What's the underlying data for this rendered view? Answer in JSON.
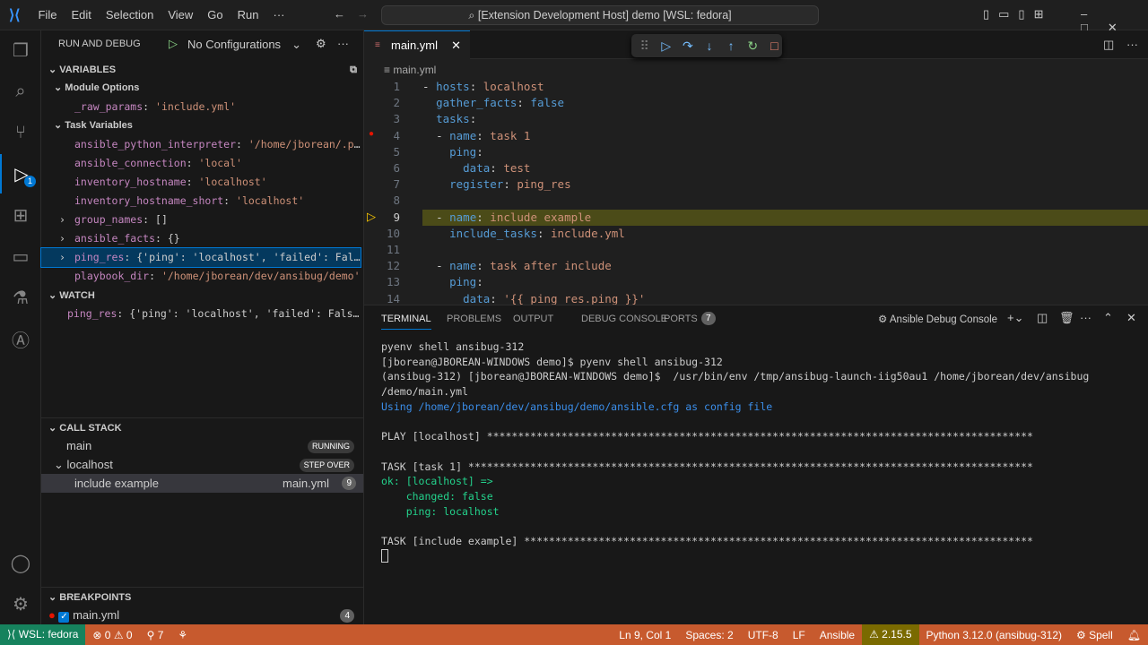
{
  "title": "[Extension Development Host] demo [WSL: fedora]",
  "menu": [
    "File",
    "Edit",
    "Selection",
    "View",
    "Go",
    "Run",
    "···"
  ],
  "activity": {
    "debug_badge": "1"
  },
  "sidebar": {
    "header": "RUN AND DEBUG",
    "config": "No Configurations",
    "variables": {
      "title": "VARIABLES",
      "module_options": {
        "label": "Module Options",
        "items": [
          {
            "name": "_raw_params",
            "value": "'include.yml'"
          }
        ]
      },
      "task_variables": {
        "label": "Task Variables",
        "items": [
          {
            "name": "ansible_python_interpreter",
            "value": "'/home/jborean/.pyenv/...'",
            "expand": ""
          },
          {
            "name": "ansible_connection",
            "value": "'local'",
            "expand": ""
          },
          {
            "name": "inventory_hostname",
            "value": "'localhost'",
            "expand": ""
          },
          {
            "name": "inventory_hostname_short",
            "value": "'localhost'",
            "expand": ""
          },
          {
            "name": "group_names",
            "value": "[]",
            "expand": "›"
          },
          {
            "name": "ansible_facts",
            "value": "{}",
            "expand": "›"
          },
          {
            "name": "ping_res",
            "value": "{'ping': 'localhost', 'failed': False...}",
            "expand": "›"
          },
          {
            "name": "playbook_dir",
            "value": "'/home/jborean/dev/ansibug/demo'",
            "expand": ""
          }
        ]
      }
    },
    "watch": {
      "title": "WATCH",
      "items": [
        {
          "name": "ping_res",
          "value": "{'ping': 'localhost', 'failed': False...}"
        }
      ]
    },
    "callstack": {
      "title": "CALL STACK",
      "threads": [
        {
          "name": "main",
          "state": "RUNNING"
        },
        {
          "name": "localhost",
          "state": "STEP OVER"
        }
      ],
      "frame": {
        "name": "include example",
        "file": "main.yml",
        "line": "9"
      }
    },
    "breakpoints": {
      "title": "BREAKPOINTS",
      "items": [
        {
          "file": "main.yml",
          "count": "4"
        }
      ]
    }
  },
  "editor": {
    "tab": "main.yml",
    "breadcrumb": "main.yml",
    "lines": [
      {
        "n": "1",
        "ind": "",
        "dash": "- ",
        "key": "hosts",
        "val": " localhost"
      },
      {
        "n": "2",
        "ind": "  ",
        "dash": "",
        "key": "gather_facts",
        "val": " false"
      },
      {
        "n": "3",
        "ind": "  ",
        "dash": "",
        "key": "tasks",
        "val": ""
      },
      {
        "n": "4",
        "ind": "  ",
        "dash": "- ",
        "key": "name",
        "val": " task 1"
      },
      {
        "n": "5",
        "ind": "    ",
        "dash": "",
        "key": "ping",
        "val": ""
      },
      {
        "n": "6",
        "ind": "      ",
        "dash": "",
        "key": "data",
        "val": " test"
      },
      {
        "n": "7",
        "ind": "    ",
        "dash": "",
        "key": "register",
        "val": " ping_res"
      },
      {
        "n": "8",
        "ind": "",
        "dash": "",
        "key": "",
        "val": ""
      },
      {
        "n": "9",
        "ind": "  ",
        "dash": "- ",
        "key": "name",
        "val": " include example"
      },
      {
        "n": "10",
        "ind": "    ",
        "dash": "",
        "key": "include_tasks",
        "val": " include.yml"
      },
      {
        "n": "11",
        "ind": "",
        "dash": "",
        "key": "",
        "val": ""
      },
      {
        "n": "12",
        "ind": "  ",
        "dash": "- ",
        "key": "name",
        "val": " task after include"
      },
      {
        "n": "13",
        "ind": "    ",
        "dash": "",
        "key": "ping",
        "val": ""
      },
      {
        "n": "14",
        "ind": "      ",
        "dash": "",
        "key": "data",
        "val": " '{{ ping_res.ping }}'"
      }
    ]
  },
  "panel": {
    "tabs": [
      "TERMINAL",
      "PROBLEMS",
      "OUTPUT",
      "DEBUG CONSOLE",
      "PORTS"
    ],
    "ports_count": "7",
    "terminal_name": "Ansible Debug Console",
    "lines": [
      {
        "t": "pyenv shell ansibug-312",
        "c": "#cccccc"
      },
      {
        "t": "[jborean@JBOREAN-WINDOWS demo]$ pyenv shell ansibug-312",
        "c": "#cccccc"
      },
      {
        "t": "(ansibug-312) [jborean@JBOREAN-WINDOWS demo]$  /usr/bin/env /tmp/ansibug-launch-iig50au1 /home/jborean/dev/ansibug",
        "c": "#cccccc"
      },
      {
        "t": "/demo/main.yml",
        "c": "#cccccc"
      },
      {
        "t": "Using /home/jborean/dev/ansibug/demo/ansible.cfg as config file",
        "c": "#3b8eea"
      },
      {
        "t": "",
        "c": "#cccccc"
      },
      {
        "t": "PLAY [localhost] ****************************************************************************************",
        "c": "#cccccc"
      },
      {
        "t": "",
        "c": "#cccccc"
      },
      {
        "t": "TASK [task 1] *******************************************************************************************",
        "c": "#cccccc"
      },
      {
        "t": "ok: [localhost] =>",
        "c": "#23d18b"
      },
      {
        "t": "    changed: false",
        "c": "#23d18b"
      },
      {
        "t": "    ping: localhost",
        "c": "#23d18b"
      },
      {
        "t": "",
        "c": "#cccccc"
      },
      {
        "t": "TASK [include example] **********************************************************************************",
        "c": "#cccccc"
      }
    ]
  },
  "status": {
    "remote": "WSL: fedora",
    "errors": "0",
    "warnings": "0",
    "ports": "7",
    "position": "Ln 9, Col 1",
    "spaces": "Spaces: 2",
    "encoding": "UTF-8",
    "eol": "LF",
    "language": "Ansible",
    "ansible_version": "⚠ 2.15.5",
    "python": "Python 3.12.0 (ansibug-312)",
    "spell": "Spell"
  }
}
